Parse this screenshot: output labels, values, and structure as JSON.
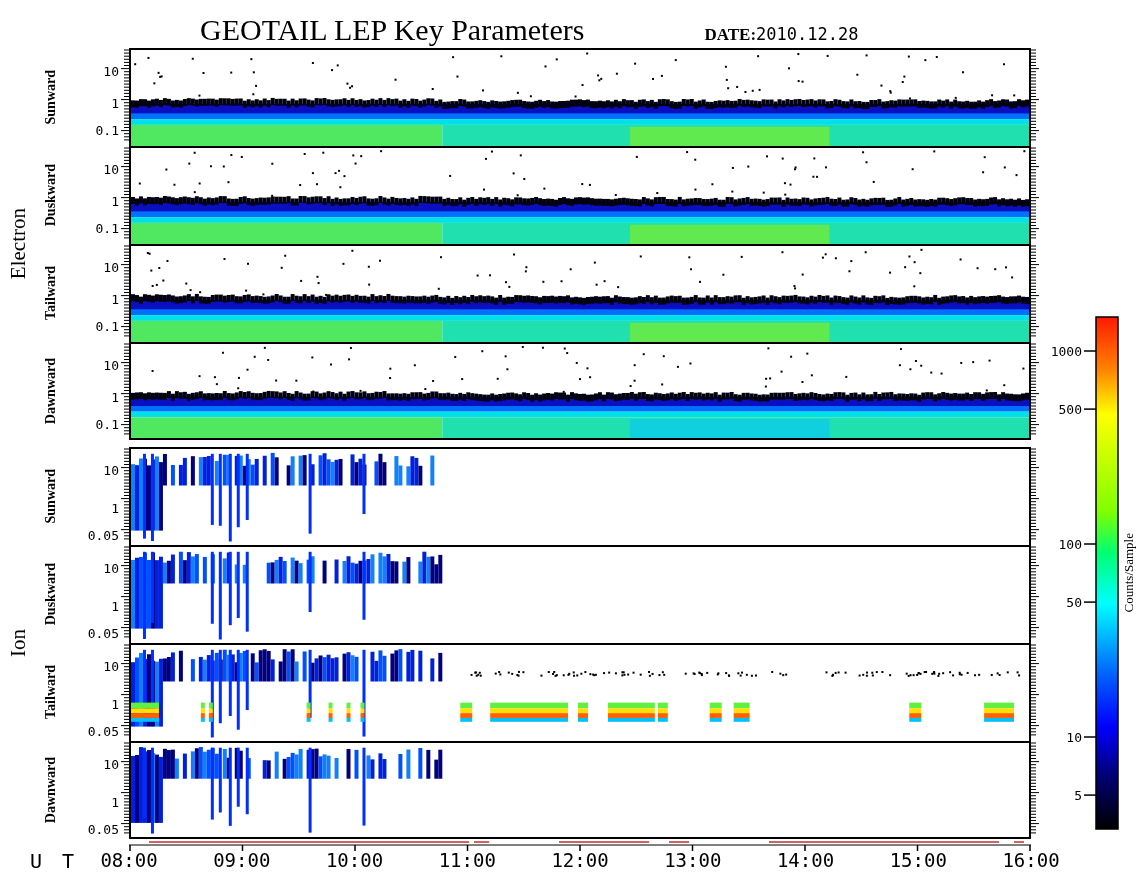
{
  "title": "GEOTAIL LEP Key Parameters",
  "date": {
    "label": "DATE:",
    "value": "2010.12.28"
  },
  "groups": [
    {
      "name": "Electron",
      "kind": "electron",
      "panels": [
        {
          "name": "Sunward",
          "yticks": [
            "10",
            "1",
            "0.1"
          ]
        },
        {
          "name": "Duskward",
          "yticks": [
            "10",
            "1",
            "0.1"
          ]
        },
        {
          "name": "Tailward",
          "yticks": [
            "10",
            "1",
            "0.1"
          ]
        },
        {
          "name": "Dawnward",
          "yticks": [
            "10",
            "1",
            "0.1"
          ]
        }
      ]
    },
    {
      "name": "Ion",
      "kind": "ion",
      "panels": [
        {
          "name": "Sunward",
          "yticks": [
            "10",
            "1",
            "0.05"
          ]
        },
        {
          "name": "Duskward",
          "yticks": [
            "10",
            "1",
            "0.05"
          ]
        },
        {
          "name": "Tailward",
          "yticks": [
            "10",
            "1",
            "0.05"
          ]
        },
        {
          "name": "Dawnward",
          "yticks": [
            "10",
            "1",
            "0.05"
          ]
        }
      ]
    }
  ],
  "time_axis": {
    "label": "U T",
    "ticks": [
      "08:00",
      "09:00",
      "10:00",
      "11:00",
      "12:00",
      "13:00",
      "14:00",
      "15:00",
      "16:00"
    ]
  },
  "colorbar": {
    "label": "Counts/Sample",
    "ticks": [
      "1000",
      "500",
      "100",
      "50",
      "10",
      "5"
    ]
  }
}
